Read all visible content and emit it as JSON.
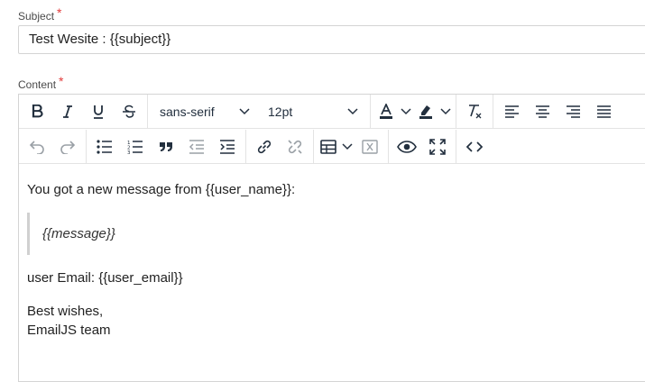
{
  "subject": {
    "label": "Subject",
    "required_mark": "*",
    "value": "Test Wesite : {{subject}}"
  },
  "content": {
    "label": "Content",
    "required_mark": "*",
    "toolbar": {
      "font_family": "sans-serif",
      "font_size": "12pt"
    },
    "body": {
      "line1": "You got a new message from {{user_name}}:",
      "quote": "{{message}}",
      "line2": "user Email: {{user_email}}",
      "line3": "Best wishes,",
      "line4": "EmailJS team"
    }
  },
  "colors": {
    "required": "#e23b3b",
    "icon": "#222f3e",
    "border": "#d4d4d4"
  }
}
